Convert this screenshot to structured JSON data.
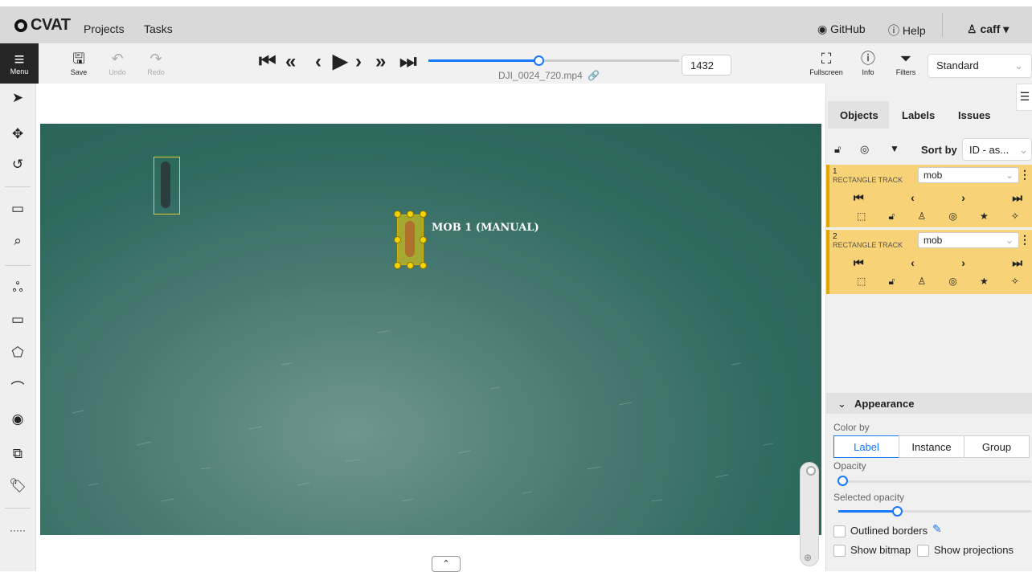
{
  "app": {
    "logo": "CVAT"
  },
  "topnav": {
    "projects": "Projects",
    "tasks": "Tasks",
    "github": "GitHub",
    "help": "Help",
    "user": "caff"
  },
  "toolbar": {
    "menu": "Menu",
    "save": "Save",
    "undo": "Undo",
    "redo": "Redo",
    "filename": "DJI_0024_720.mp4",
    "frame": "1432",
    "frame_progress": 0.44,
    "fullscreen": "Fullscreen",
    "info": "Info",
    "filters": "Filters",
    "workspace": "Standard"
  },
  "canvas": {
    "shape_label": "MOB 1 (MANUAL)"
  },
  "sidebar": {
    "tabs": {
      "objects": "Objects",
      "labels": "Labels",
      "issues": "Issues"
    },
    "sort_by_label": "Sort by",
    "sort_value": "ID - as...",
    "objects": [
      {
        "id": "1",
        "type": "RECTANGLE TRACK",
        "label": "mob"
      },
      {
        "id": "2",
        "type": "RECTANGLE TRACK",
        "label": "mob"
      }
    ],
    "appearance": {
      "title": "Appearance",
      "color_by": "Color by",
      "color_options": [
        "Label",
        "Instance",
        "Group"
      ],
      "selected_color": "Label",
      "opacity_label": "Opacity",
      "opacity_value": 0,
      "selected_opacity_label": "Selected opacity",
      "selected_opacity_value": 0.4,
      "outlined_borders": "Outlined borders",
      "show_bitmap": "Show bitmap",
      "show_projections": "Show projections"
    }
  },
  "colors": {
    "accent": "#1677ff",
    "annotation_yellow": "#f5d300",
    "object_card": "#f7d276"
  }
}
